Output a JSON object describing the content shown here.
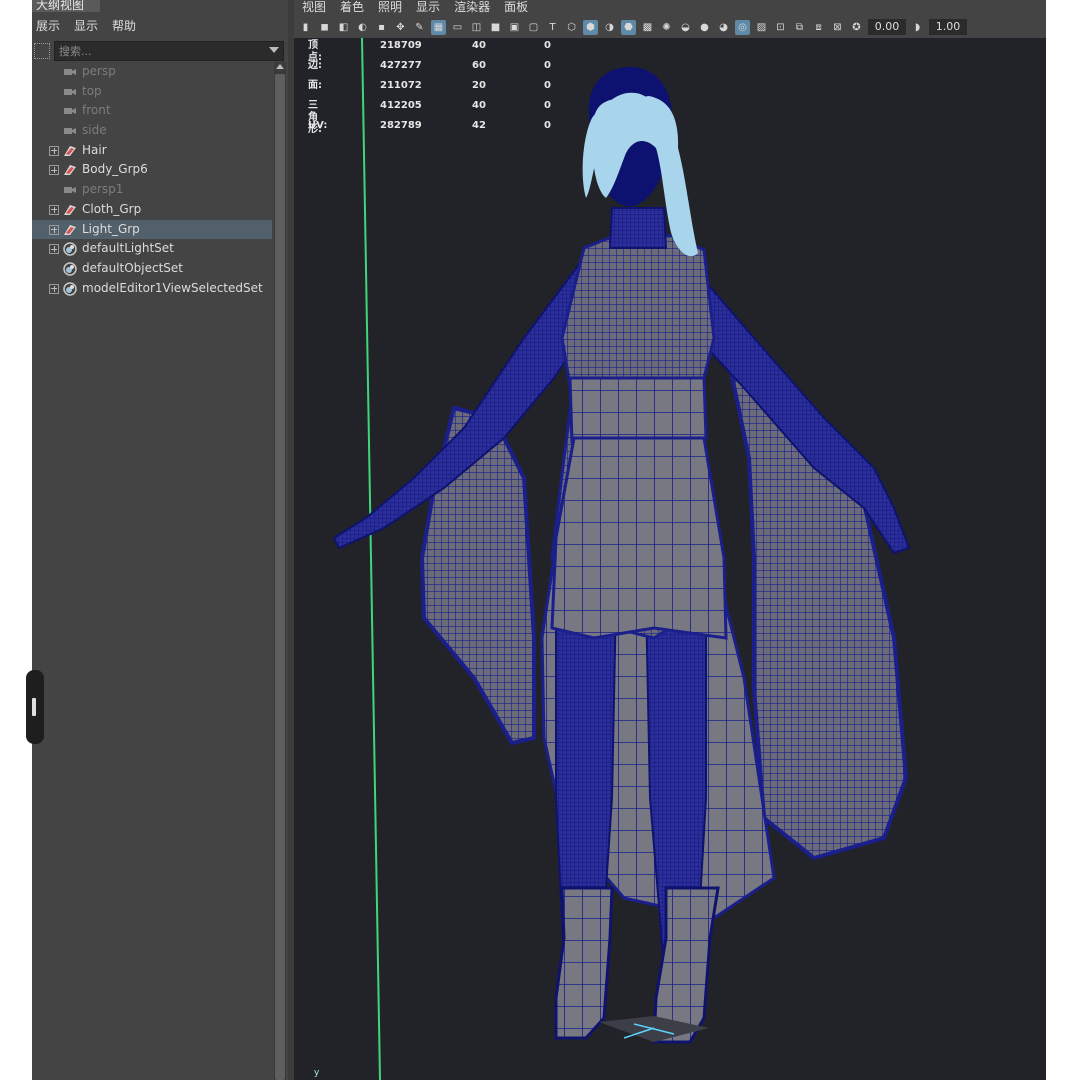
{
  "outliner": {
    "title": "大纲视图",
    "menu": [
      "展示",
      "显示",
      "帮助"
    ],
    "search_placeholder": "搜索...",
    "items": [
      {
        "label": "persp",
        "icon": "camera-icon",
        "dim": true,
        "expandable": false
      },
      {
        "label": "top",
        "icon": "camera-icon",
        "dim": true,
        "expandable": false
      },
      {
        "label": "front",
        "icon": "camera-icon",
        "dim": true,
        "expandable": false
      },
      {
        "label": "side",
        "icon": "camera-icon",
        "dim": true,
        "expandable": false
      },
      {
        "label": "Hair",
        "icon": "group-icon",
        "dim": false,
        "expandable": true
      },
      {
        "label": "Body_Grp6",
        "icon": "group-icon",
        "dim": false,
        "expandable": true
      },
      {
        "label": "persp1",
        "icon": "camera-icon",
        "dim": true,
        "expandable": false
      },
      {
        "label": "Cloth_Grp",
        "icon": "group-icon",
        "dim": false,
        "expandable": true
      },
      {
        "label": "Light_Grp",
        "icon": "group-icon",
        "dim": false,
        "expandable": true,
        "selected": true
      },
      {
        "label": "defaultLightSet",
        "icon": "set-icon",
        "dim": false,
        "expandable": true
      },
      {
        "label": "defaultObjectSet",
        "icon": "set-icon",
        "dim": false,
        "expandable": false
      },
      {
        "label": "modelEditor1ViewSelectedSet",
        "icon": "set-icon",
        "dim": false,
        "expandable": true
      }
    ]
  },
  "viewport": {
    "menu": [
      "视图",
      "着色",
      "照明",
      "显示",
      "渲染器",
      "面板"
    ],
    "toolbar_values": {
      "exposure": "0.00",
      "gamma": "1.00"
    },
    "hud": [
      {
        "label": "顶点:",
        "total": "218709",
        "selected": "40",
        "uv": "0"
      },
      {
        "label": "边:",
        "total": "427277",
        "selected": "60",
        "uv": "0"
      },
      {
        "label": "面:",
        "total": "211072",
        "selected": "20",
        "uv": "0"
      },
      {
        "label": "三角形:",
        "total": "412205",
        "selected": "40",
        "uv": "0"
      },
      {
        "label": "UV:",
        "total": "282789",
        "selected": "42",
        "uv": "0"
      }
    ],
    "axis_label": "y"
  },
  "colors": {
    "panel_bg": "#444444",
    "viewport_bg": "#212328",
    "selection": "#52606b",
    "wireframe": "#1a1f8c",
    "hair_highlight": "#a8d4ec",
    "mesh_fill": "#6f6f7c",
    "grid_axis": "#3ed67a"
  }
}
